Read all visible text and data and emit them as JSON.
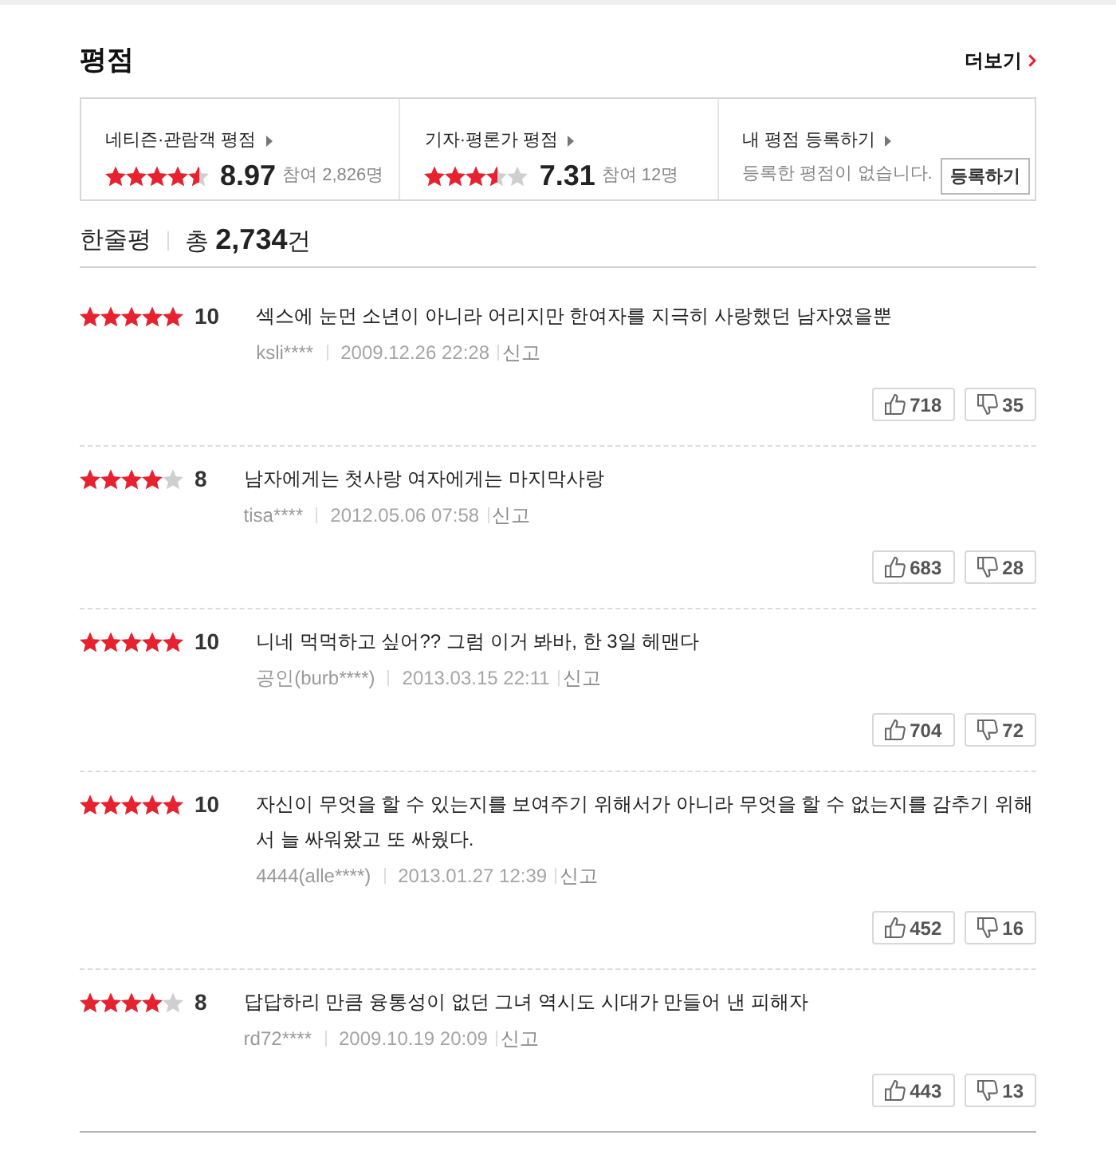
{
  "header": {
    "title": "평점",
    "more_link": "더보기"
  },
  "rating_summary": [
    {
      "kind": "score",
      "title": "네티즌·관람객 평점",
      "stars": 4.5,
      "score": "8.97",
      "participants": "참여 2,826명"
    },
    {
      "kind": "score",
      "title": "기자·평론가 평점",
      "stars": 3.5,
      "score": "7.31",
      "participants": "참여 12명"
    },
    {
      "kind": "register",
      "title": "내 평점 등록하기",
      "message": "등록한 평점이 없습니다.",
      "button": "등록하기"
    }
  ],
  "reviews_header": {
    "title": "한줄평",
    "total": "총 **2,734**건"
  },
  "reviews": [
    {
      "stars": 5,
      "score": "10",
      "text": "섹스에 눈먼 소년이 아니라 어리지만 한여자를 지극히 사랑했던 남자였을뿐",
      "author": "ksli****",
      "date": "2009.12.26 22:28",
      "report": "신고",
      "likes": "718",
      "dislikes": "35"
    },
    {
      "stars": 4,
      "score": "8",
      "text": "남자에게는 첫사랑 여자에게는 마지막사랑",
      "author": "tisa****",
      "date": "2012.05.06 07:58",
      "report": "신고",
      "likes": "683",
      "dislikes": "28"
    },
    {
      "stars": 5,
      "score": "10",
      "text": "니네 먹먹하고 싶어?? 그럼 이거 봐바, 한 3일 헤맨다",
      "author": "공인(burb****)",
      "date": "2013.03.15 22:11",
      "report": "신고",
      "likes": "704",
      "dislikes": "72"
    },
    {
      "stars": 5,
      "score": "10",
      "text": "자신이 무엇을 할 수 있는지를 보여주기 위해서가 아니라 무엇을 할 수 없는지를 감추기 위해서 늘 싸워왔고 또 싸웠다.",
      "author": "4444(alle****)",
      "date": "2013.01.27 12:39",
      "report": "신고",
      "likes": "452",
      "dislikes": "16"
    },
    {
      "stars": 4,
      "score": "8",
      "text": "답답하리 만큼 융통성이 없던 그녀 역시도 시대가 만들어 낸 피해자",
      "author": "rd72****",
      "date": "2009.10.19 20:09",
      "report": "신고",
      "likes": "443",
      "dislikes": "13"
    }
  ]
}
